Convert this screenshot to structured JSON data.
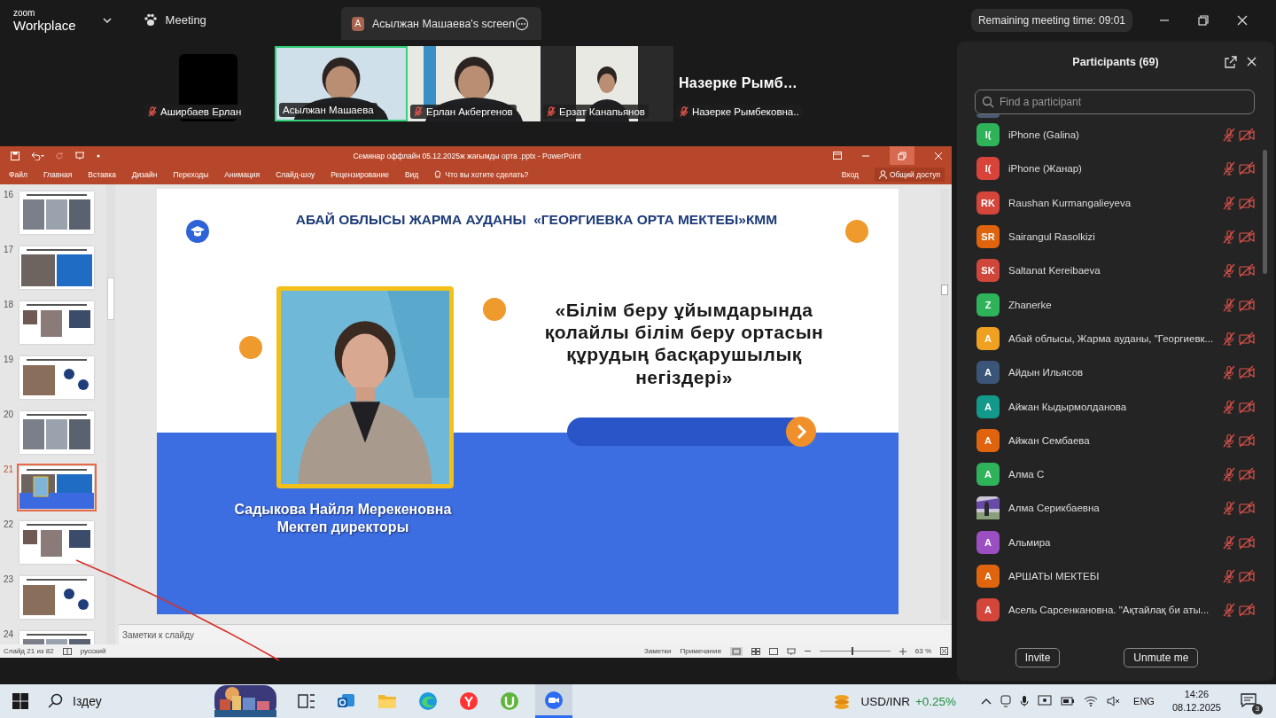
{
  "topbar": {
    "logo_top": "zoom",
    "logo_bottom": "Workplace",
    "meeting_label": "Meeting",
    "share_tab": {
      "avatar": "A",
      "label": "Асылжан Машаева's screen"
    },
    "remaining": "Remaining meeting time: 09:01"
  },
  "videos": [
    {
      "name": "Аширбаев Ерлан",
      "kind": "camera_off",
      "muted": true,
      "active": false
    },
    {
      "name": "Асылжан Машаева",
      "kind": "picture",
      "muted": false,
      "active": true
    },
    {
      "name": "Ерлан Акбергенов",
      "kind": "picture",
      "muted": true,
      "active": false
    },
    {
      "name": "Ерзат Канапьянов",
      "kind": "picture",
      "muted": true,
      "active": false
    },
    {
      "name": "Назерке  Рымбековна..",
      "kind": "name_only",
      "display_name": "Назерке  Рымб…",
      "muted": true,
      "active": false
    }
  ],
  "powerpoint": {
    "title": "Семинар оффлайн 05.12.2025ж жағымды орта .pptx - PowerPoint",
    "menu": [
      "Файл",
      "Главная",
      "Вставка",
      "Дизайн",
      "Переходы",
      "Анимация",
      "Слайд-шоу",
      "Рецензирование",
      "Вид"
    ],
    "tell_me": "Что вы хотите сделать?",
    "sign_in": "Вход",
    "share": "Общий доступ",
    "thumbnails": [
      {
        "number": "16",
        "selected": false
      },
      {
        "number": "17",
        "selected": false
      },
      {
        "number": "18",
        "selected": false
      },
      {
        "number": "19",
        "selected": false
      },
      {
        "number": "20",
        "selected": false
      },
      {
        "number": "21",
        "selected": true
      },
      {
        "number": "22",
        "selected": false
      },
      {
        "number": "23",
        "selected": false
      },
      {
        "number": "24",
        "selected": false
      }
    ],
    "slide": {
      "header": "АБАЙ ОБЛЫСЫ ЖАРМА АУДАНЫ  «ГЕОРГИЕВКА ОРТА МЕКТЕБІ»КММ",
      "heading": "«Білім беру ұйымдарында қолайлы білім беру ортасын құрудың басқарушылық негіздері»",
      "person_name": "Садыкова Найля Мерекеновна",
      "person_role": "Мектеп директоры"
    },
    "notes_placeholder": "Заметки к слайду",
    "status": {
      "slide": "Слайд 21 из 82",
      "language": "русский",
      "notes": "Заметки",
      "comments": "Примечания",
      "zoom": "63 %",
      "zoom_slider": {
        "level": 0.45
      }
    }
  },
  "participants": {
    "title": "Participants (69)",
    "search_placeholder": "Find a participant",
    "items": [
      {
        "kind": "initials",
        "initials": "I(",
        "color": "#2eb35a",
        "name": "iPhone (Galina)",
        "muted": true,
        "video_off": true
      },
      {
        "kind": "initials",
        "initials": "I(",
        "color": "#d9443a",
        "name": "iPhone (Жанар)",
        "muted": true,
        "video_off": true
      },
      {
        "kind": "initials",
        "initials": "RK",
        "color": "#d4453a",
        "name": "Raushan Kurmangalieyeva",
        "muted": true,
        "video_off": true
      },
      {
        "kind": "initials",
        "initials": "SR",
        "color": "#e0640e",
        "name": "Sairangul Rasolkizi",
        "muted": true,
        "video_off": true
      },
      {
        "kind": "initials",
        "initials": "SK",
        "color": "#d0463a",
        "name": "Saltanat Kereibaeva",
        "muted": true,
        "video_off": true
      },
      {
        "kind": "initials",
        "initials": "Z",
        "color": "#2eb35a",
        "name": "Zhanerke",
        "muted": true,
        "video_off": true
      },
      {
        "kind": "initials",
        "initials": "A",
        "color": "#f0a020",
        "name": "Абай облысы, Жарма ауданы, \"Георгиевк...",
        "muted": true,
        "video_off": true
      },
      {
        "kind": "initials",
        "initials": "A",
        "color": "#3a5578",
        "name": "Айдын Ильясов",
        "muted": true,
        "video_off": true
      },
      {
        "kind": "initials",
        "initials": "A",
        "color": "#12998a",
        "name": "Айжан Кыдырмолданова",
        "muted": true,
        "video_off": true
      },
      {
        "kind": "initials",
        "initials": "A",
        "color": "#e0640e",
        "name": "Айжан Сембаева",
        "muted": true,
        "video_off": true
      },
      {
        "kind": "initials",
        "initials": "A",
        "color": "#2eb35a",
        "name": "Алма С",
        "muted": true,
        "video_off": true
      },
      {
        "kind": "picture",
        "name": "Алма Серикбаевна",
        "muted": true,
        "video_off": true
      },
      {
        "kind": "initials",
        "initials": "A",
        "color": "#9b4fc2",
        "name": "Альмира",
        "muted": true,
        "video_off": true
      },
      {
        "kind": "initials",
        "initials": "A",
        "color": "#e0640e",
        "name": "АРШАТЫ МЕКТЕБІ",
        "muted": true,
        "video_off": true
      },
      {
        "kind": "initials",
        "initials": "A",
        "color": "#d4453a",
        "name": "Асель Сарсенкановна.  \"Ақтайлақ би аты...",
        "muted": true,
        "video_off": true
      }
    ],
    "buttons": [
      "Invite",
      "Unmute me"
    ]
  },
  "taskbar": {
    "search": "Іздеу",
    "ticker": "USD/INR",
    "change": "+0.25%",
    "language": "ENG",
    "time": "14:26",
    "date": "08.12.2025",
    "notifications": "3"
  }
}
